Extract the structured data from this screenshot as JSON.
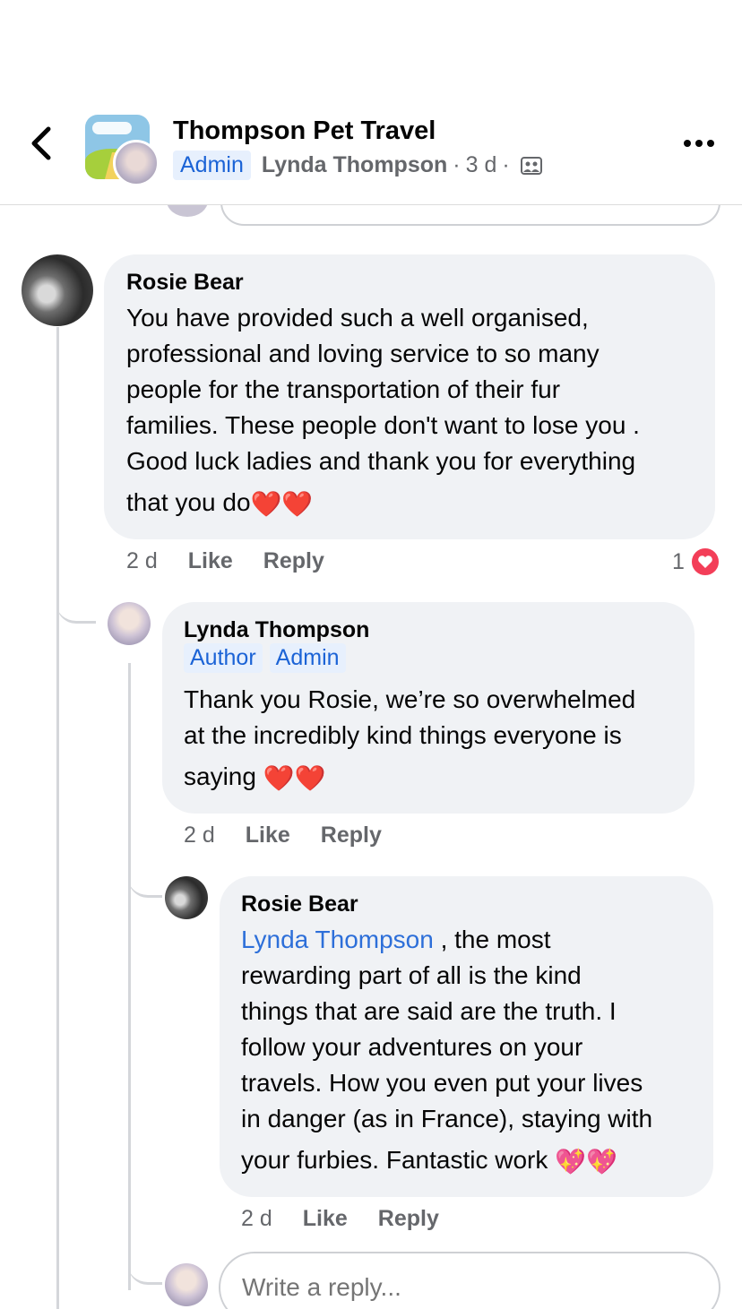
{
  "header": {
    "title": "Thompson Pet Travel",
    "badge": "Admin",
    "poster": "Lynda Thompson",
    "sep1": "·",
    "time": "3 d",
    "sep2": "·"
  },
  "comments": [
    {
      "author": "Rosie Bear",
      "lines": [
        "You have provided such a well organised,",
        "professional and loving service to so many",
        "people for the transportation of their fur",
        "families. These people don't want to lose you .",
        "Good luck ladies and thank you for everything",
        "that you do"
      ],
      "emoji": "❤️❤️",
      "time": "2 d",
      "like": "Like",
      "reply": "Reply",
      "reaction_count": "1"
    },
    {
      "author": "Lynda Thompson",
      "badges": [
        "Author",
        "Admin"
      ],
      "lines": [
        "Thank you Rosie, we’re so overwhelmed",
        "at the incredibly kind things everyone is",
        "saying"
      ],
      "emoji": "❤️❤️",
      "time": "2 d",
      "like": "Like",
      "reply": "Reply"
    },
    {
      "author": "Rosie Bear",
      "mention": "Lynda Thompson",
      "lines": [
        ", the most",
        "rewarding part of all is the kind",
        "things that are said are the truth. I",
        "follow your adventures on your",
        "travels. How you even put your lives",
        "in danger (as in France), staying with",
        "your furbies. Fantastic work"
      ],
      "emoji": "💖💖",
      "time": "2 d",
      "like": "Like",
      "reply": "Reply"
    }
  ],
  "reply_box": {
    "placeholder": "Write a reply..."
  },
  "colors": {
    "link": "#2d6fd9",
    "badge_bg": "#e7f0fd",
    "badge_text": "#1b63d6",
    "heart": "#f33e58"
  }
}
